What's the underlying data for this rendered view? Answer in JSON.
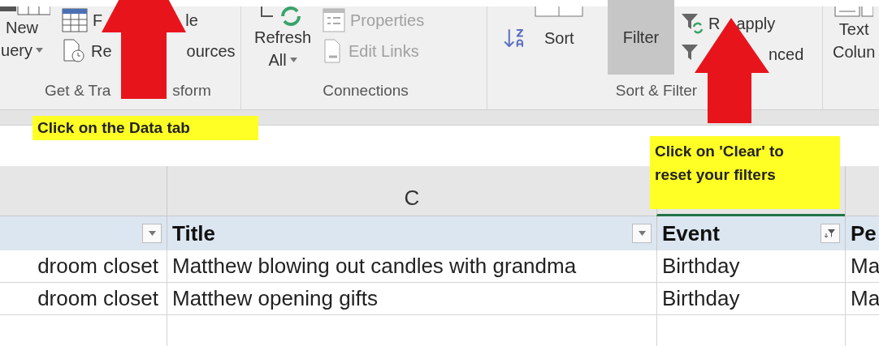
{
  "ribbon": {
    "groups": [
      {
        "label": [
          "Get & Tra",
          "sform"
        ],
        "large": {
          "lines": [
            "New",
            "uery"
          ],
          "dropdown": true
        },
        "rows": [
          {
            "parts": [
              "F",
              "le"
            ],
            "disabled": false
          },
          {
            "parts": [
              "Re",
              "ources"
            ],
            "disabled": false
          }
        ]
      },
      {
        "label": [
          "Connections"
        ],
        "large": {
          "lines": [
            "Refresh",
            "All"
          ],
          "dropdown": true
        },
        "rows": [
          {
            "parts": [
              "Properties"
            ],
            "disabled": true
          },
          {
            "parts": [
              "Edit Links"
            ],
            "disabled": true
          }
        ]
      },
      {
        "label": [
          "Sort & Filter"
        ],
        "sort": {
          "label": "Sort"
        },
        "filter": {
          "label": "Filter",
          "selected": true
        },
        "rows": [
          {
            "parts": [
              "R",
              "apply"
            ],
            "disabled": false
          },
          {
            "parts": [
              "nced"
            ],
            "disabled": false
          }
        ]
      },
      {
        "large": {
          "lines": [
            "Text",
            "Colun"
          ]
        }
      }
    ]
  },
  "sheet": {
    "columns": [
      {
        "selected": false
      },
      {
        "label": "C",
        "selected": false
      },
      {
        "selected": true
      },
      {
        "selected": false
      }
    ],
    "header": [
      {
        "kind": "dropdown"
      },
      {
        "text": "Title",
        "kind": "dropdown"
      },
      {
        "text": "Event",
        "kind": "filtered"
      },
      {
        "text": "Pe",
        "kind": "plain"
      }
    ],
    "rows": [
      [
        "droom closet",
        "Matthew blowing out candles with grandma",
        "Birthday",
        "Ma"
      ],
      [
        "droom closet",
        "Matthew opening gifts",
        "Birthday",
        "Ma"
      ],
      []
    ]
  },
  "callouts": [
    {
      "text": "Click on the Data tab"
    },
    {
      "text": "Click on 'Clear' to reset your filters"
    }
  ]
}
